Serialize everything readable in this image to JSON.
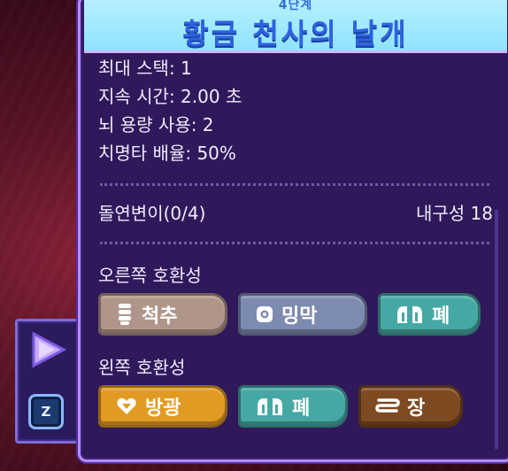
{
  "item": {
    "subtitle": "4단계",
    "title": "황금 천사의 날개"
  },
  "stats": [
    "최대 스택: 1",
    "지속 시간: 2.00 초",
    "뇌 용량 사용: 2",
    "치명타 배율: 50%"
  ],
  "mutation_label": "돌연변이(0/4)",
  "durability_label": "내구성 18",
  "right_compat": {
    "label": "오른쪽 호환성",
    "tags": [
      {
        "label": "척추",
        "icon": "spine-icon",
        "color": "#b0968a"
      },
      {
        "label": "밍막",
        "icon": "membrane-icon",
        "color": "#7e8bb0"
      },
      {
        "label": "폐",
        "icon": "lung-icon",
        "color": "#45a8a4"
      }
    ]
  },
  "left_compat": {
    "label": "왼쪽 호환성",
    "tags": [
      {
        "label": "방광",
        "icon": "bladder-icon",
        "color": "#e19a22"
      },
      {
        "label": "폐",
        "icon": "lung-icon",
        "color": "#45a8a4"
      },
      {
        "label": "장",
        "icon": "gut-icon",
        "color": "#7d4a22"
      }
    ]
  },
  "side": {
    "key_hint": "Z"
  }
}
